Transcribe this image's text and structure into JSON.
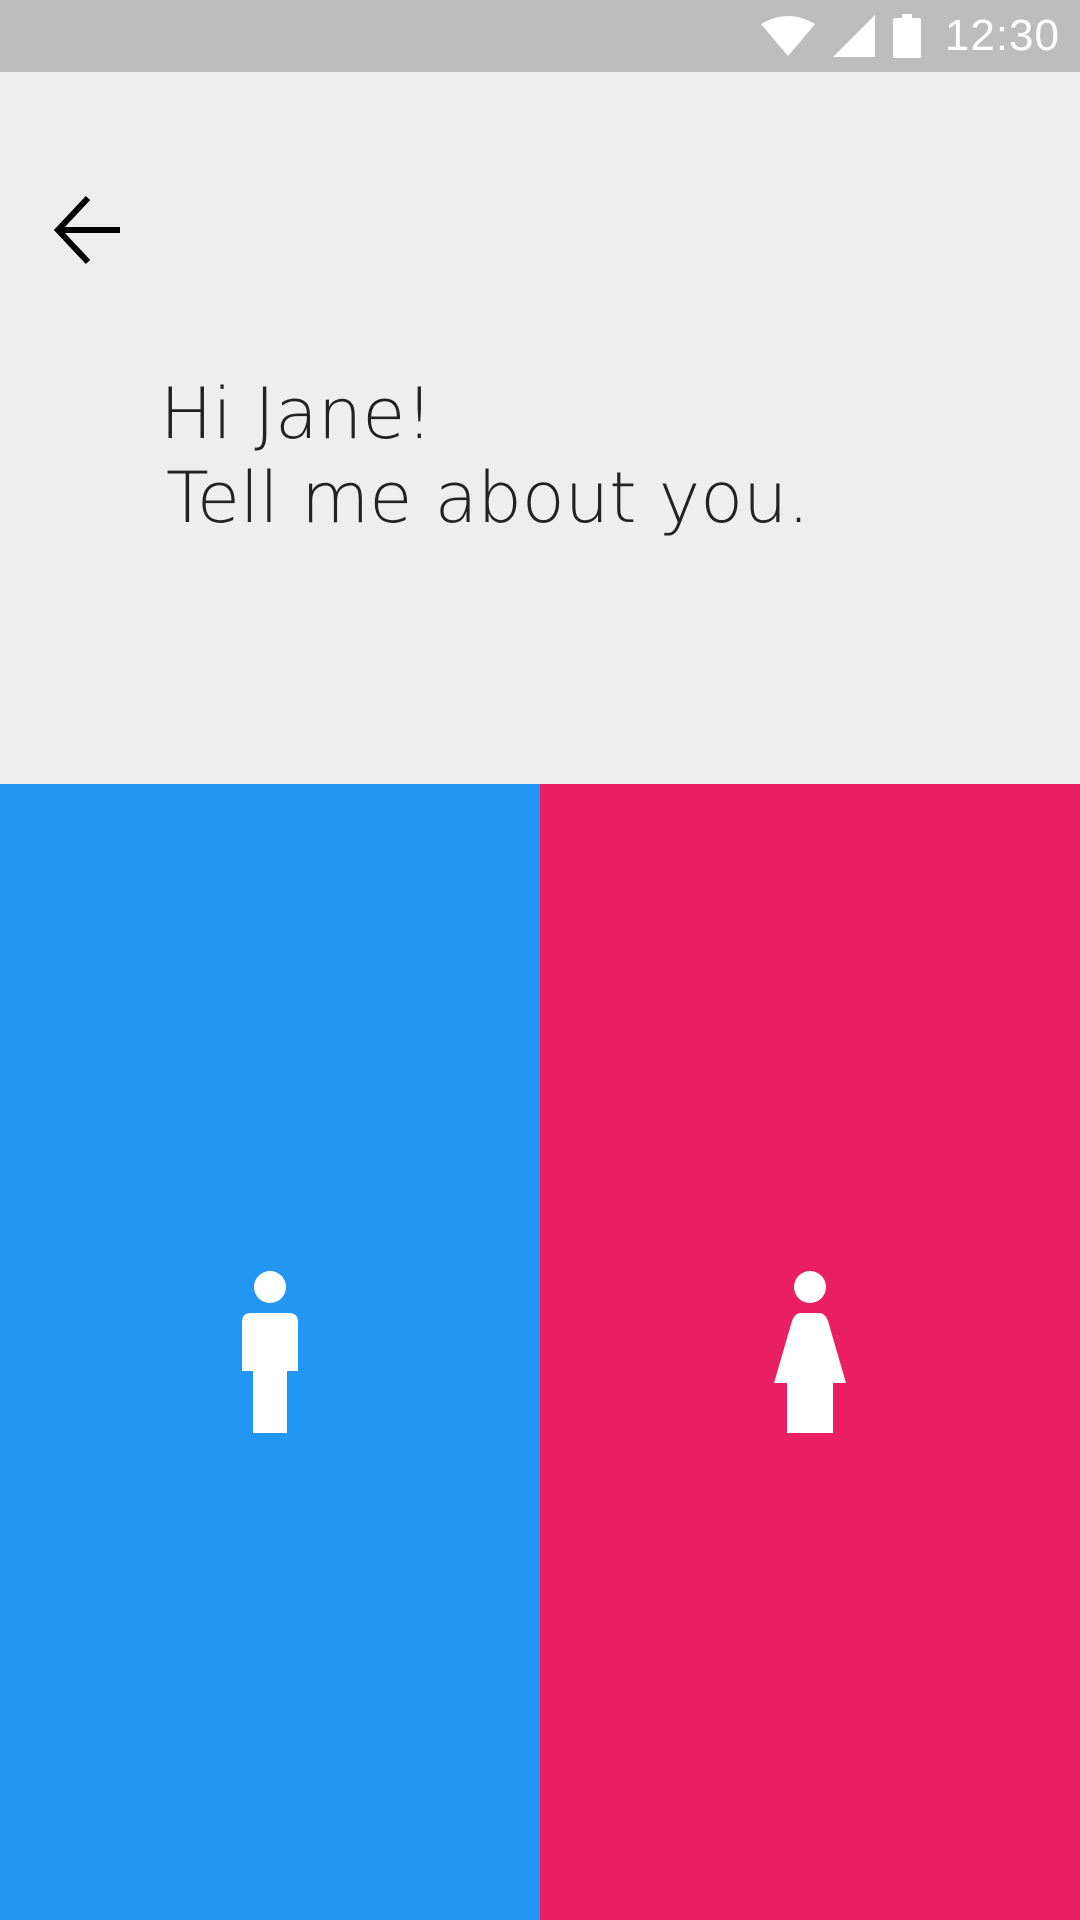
{
  "status_bar": {
    "time": "12:30",
    "icons": [
      "wifi-icon",
      "cellular-signal-icon",
      "battery-icon"
    ]
  },
  "header": {
    "back_icon": "arrow-left-icon",
    "greeting_line1": "Hi Jane!",
    "greeting_line2": "Tell me about you."
  },
  "choices": [
    {
      "id": "male",
      "icon": "male-figure-icon",
      "color": "#2196f3"
    },
    {
      "id": "female",
      "icon": "female-figure-icon",
      "color": "#e91e63"
    }
  ],
  "colors": {
    "status_bar": "#bdbdbd",
    "background": "#eeeeee",
    "text": "#222222"
  }
}
